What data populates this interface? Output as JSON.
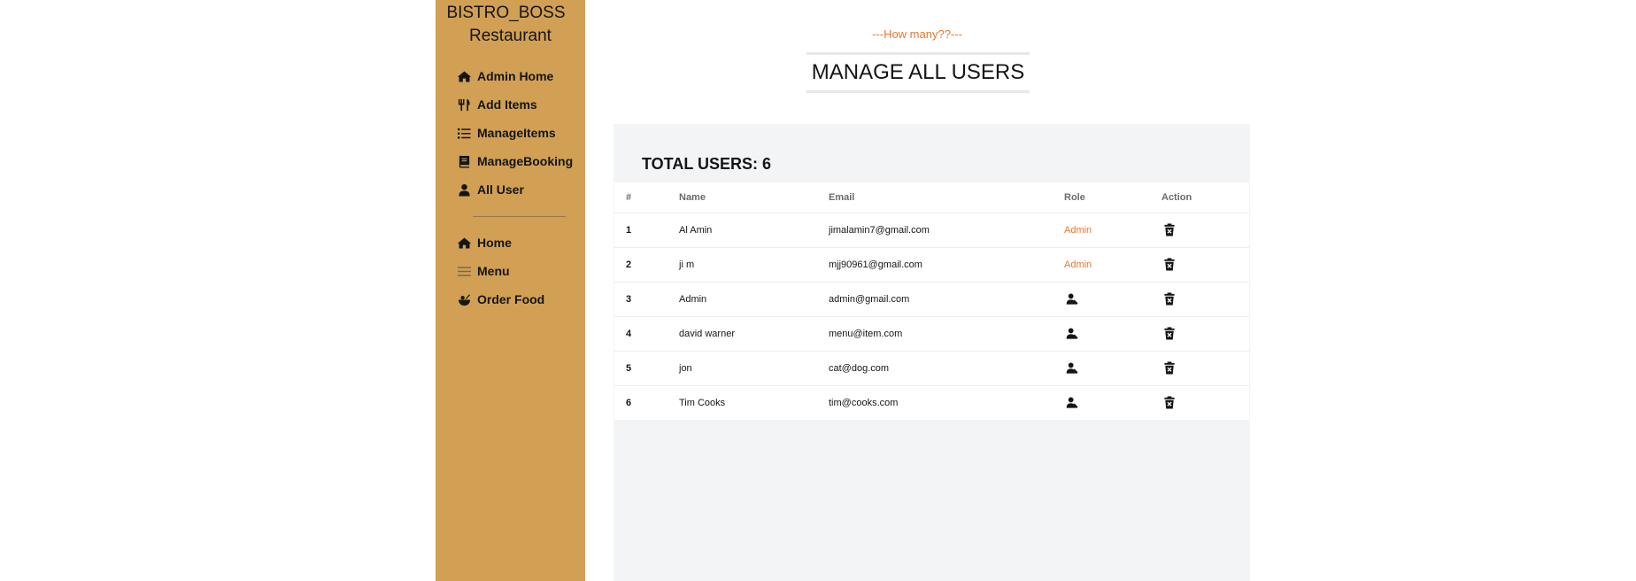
{
  "brand": {
    "line1": "BISTRO_BOSS",
    "line2": "Restaurant"
  },
  "sidebar": {
    "admin_items": [
      {
        "label": "Admin Home",
        "icon": "home-icon"
      },
      {
        "label": "Add Items",
        "icon": "utensils-icon"
      },
      {
        "label": "ManageItems",
        "icon": "list-icon"
      },
      {
        "label": "ManageBooking",
        "icon": "book-icon"
      },
      {
        "label": "All User",
        "icon": "user-icon"
      }
    ],
    "general_items": [
      {
        "label": "Home",
        "icon": "home-icon"
      },
      {
        "label": "Menu",
        "icon": "menu-icon"
      },
      {
        "label": "Order Food",
        "icon": "food-bowl-icon"
      }
    ]
  },
  "header": {
    "subheading": "---How many??---",
    "title": "MANAGE ALL USERS"
  },
  "summary": {
    "label": "TOTAL USERS:",
    "count": "6"
  },
  "table": {
    "columns": [
      "#",
      "Name",
      "Email",
      "Role",
      "Action"
    ],
    "rows": [
      {
        "num": "1",
        "name": "Al Amin",
        "email": "jimalamin7@gmail.com",
        "role": "Admin"
      },
      {
        "num": "2",
        "name": "ji m",
        "email": "mjj90961@gmail.com",
        "role": "Admin"
      },
      {
        "num": "3",
        "name": "Admin",
        "email": "admin@gmail.com",
        "role": ""
      },
      {
        "num": "4",
        "name": "david warner",
        "email": "menu@item.com",
        "role": ""
      },
      {
        "num": "5",
        "name": "jon",
        "email": "cat@dog.com",
        "role": ""
      },
      {
        "num": "6",
        "name": "Tim Cooks",
        "email": "tim@cooks.com",
        "role": ""
      }
    ]
  },
  "colors": {
    "sidebar": "#d1a054",
    "accent": "#e8772e",
    "panel": "#f3f4f6"
  }
}
